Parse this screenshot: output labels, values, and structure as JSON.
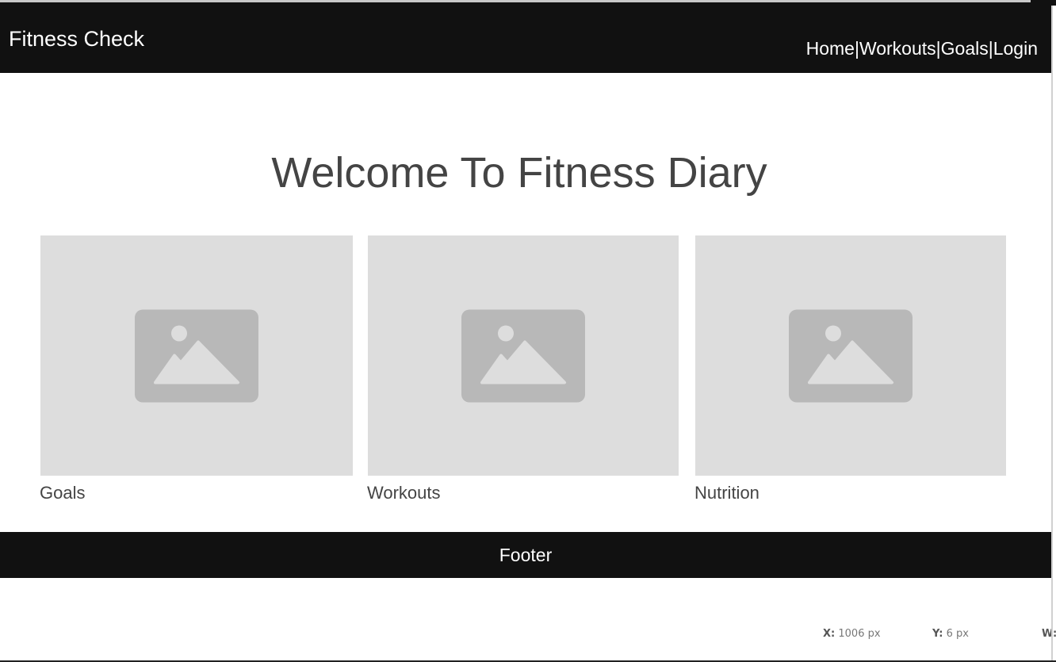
{
  "header": {
    "brand": "Fitness Check",
    "nav": [
      {
        "label": "Home"
      },
      {
        "label": "Workouts"
      },
      {
        "label": "Goals"
      },
      {
        "label": "Login"
      }
    ],
    "separator": "|"
  },
  "main": {
    "title": "Welcome To Fitness Diary",
    "cards": [
      {
        "label": "Goals",
        "image_icon": "image-placeholder-icon"
      },
      {
        "label": "Workouts",
        "image_icon": "image-placeholder-icon"
      },
      {
        "label": "Nutrition",
        "image_icon": "image-placeholder-icon"
      }
    ]
  },
  "footer": {
    "text": "Footer"
  },
  "inspector": {
    "x_label": "X:",
    "x_value": "1006 px",
    "y_label": "Y:",
    "y_value": "6 px",
    "w_label": "W:"
  },
  "colors": {
    "header_bg": "#111111",
    "header_text": "#ffffff",
    "title_text": "#444444",
    "placeholder_bg": "#dddddd",
    "placeholder_icon": "#b8b8b8"
  }
}
